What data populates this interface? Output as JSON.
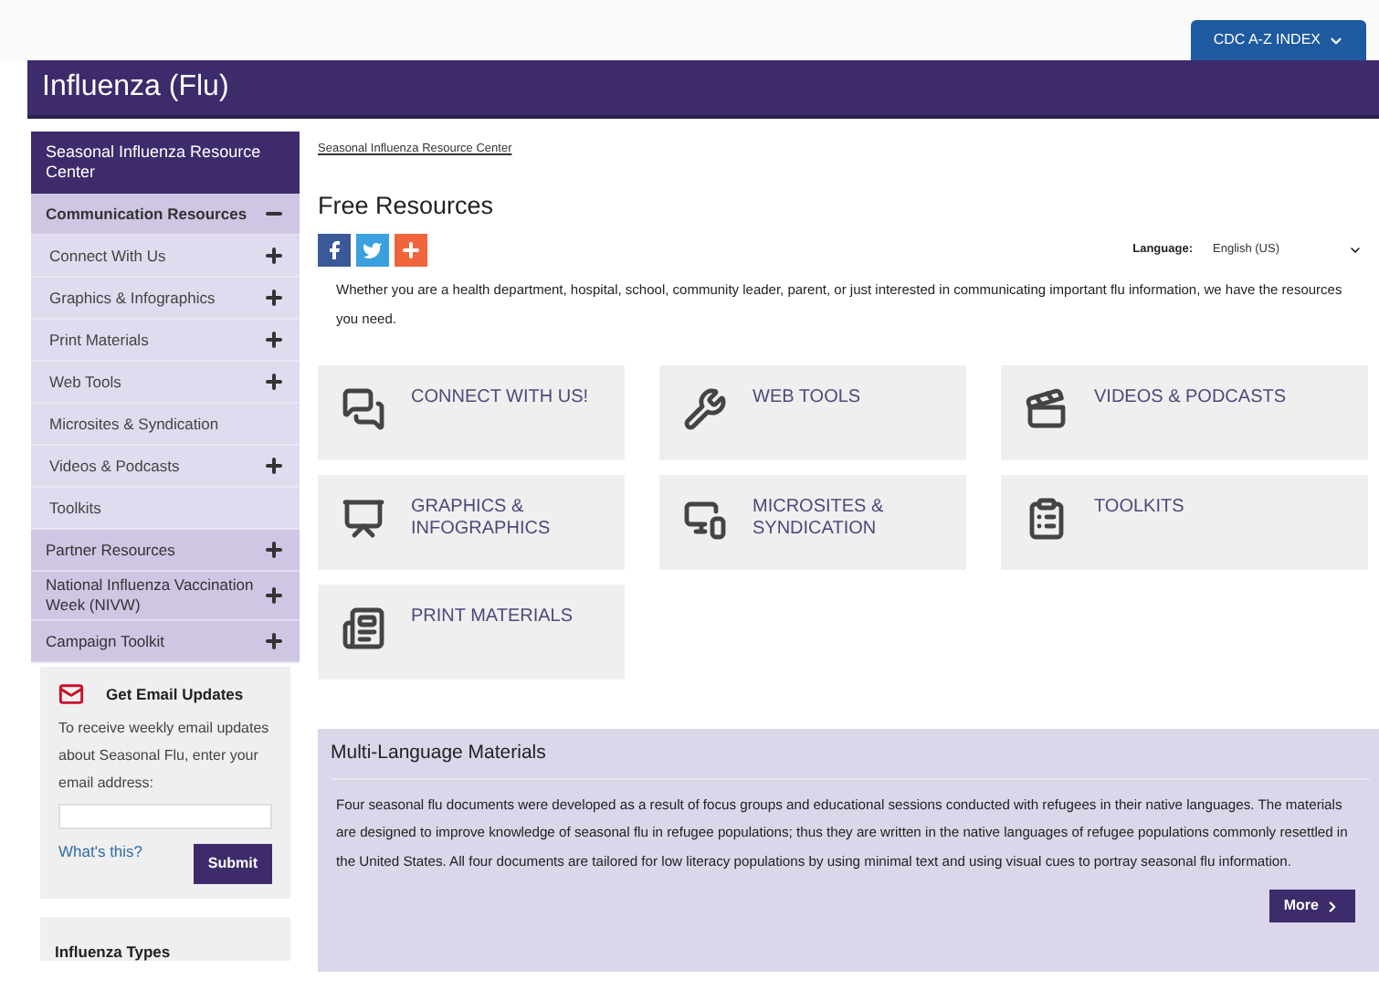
{
  "top_bar": {
    "index_button": "CDC A-Z INDEX"
  },
  "header": {
    "title": "Influenza (Flu)"
  },
  "sidebar": {
    "items": [
      {
        "kind": "header",
        "label": "Seasonal Influenza Resource Center"
      },
      {
        "kind": "section",
        "label": "Communication Resources",
        "expanded": true,
        "children": [
          {
            "label": "Connect With Us",
            "expanded": false
          },
          {
            "label": "Graphics & Infographics",
            "expanded": false
          },
          {
            "label": "Print Materials",
            "expanded": false
          },
          {
            "label": "Web Tools",
            "expanded": false
          },
          {
            "label": "Microsites & Syndication"
          },
          {
            "label": "Videos & Podcasts",
            "expanded": false
          },
          {
            "label": "Toolkits"
          }
        ]
      },
      {
        "kind": "section",
        "label": "Partner Resources",
        "expanded": false
      },
      {
        "kind": "section",
        "label": "National Influenza Vaccination Week (NIVW)",
        "expanded": false
      },
      {
        "kind": "section",
        "label": "Campaign Toolkit",
        "expanded": false
      }
    ]
  },
  "email_box": {
    "title": "Get Email Updates",
    "text": "To receive weekly email updates about Seasonal Flu, enter your email address:",
    "link": "What's this?",
    "button": "Submit"
  },
  "types_box": {
    "title": "Influenza Types"
  },
  "breadcrumb": "Seasonal Influenza Resource Center",
  "page_title": "Free Resources",
  "language": {
    "label": "Language:",
    "value": "English (US)"
  },
  "intro": "Whether you are a health department, hospital, school, community leader, parent, or just interested in communicating important flu information, we have the resources you need.",
  "tiles": [
    {
      "label": "CONNECT WITH US!"
    },
    {
      "label": "WEB TOOLS"
    },
    {
      "label": "VIDEOS & PODCASTS"
    },
    {
      "label": "GRAPHICS & INFOGRAPHICS"
    },
    {
      "label": "MICROSITES & SYNDICATION"
    },
    {
      "label": "TOOLKITS"
    },
    {
      "label": "PRINT MATERIALS"
    }
  ],
  "multi_language": {
    "title": "Multi-Language Materials",
    "text": "Four seasonal flu documents were developed as a result of focus groups and educational sessions conducted with refugees in their native languages. The materials are designed to improve knowledge of seasonal flu in refugee populations; thus they are written in the native languages of refugee populations commonly resettled in the United States. All four documents are tailored for low literacy populations by using minimal text and using visual cues to portray seasonal flu information.",
    "button": "More"
  }
}
